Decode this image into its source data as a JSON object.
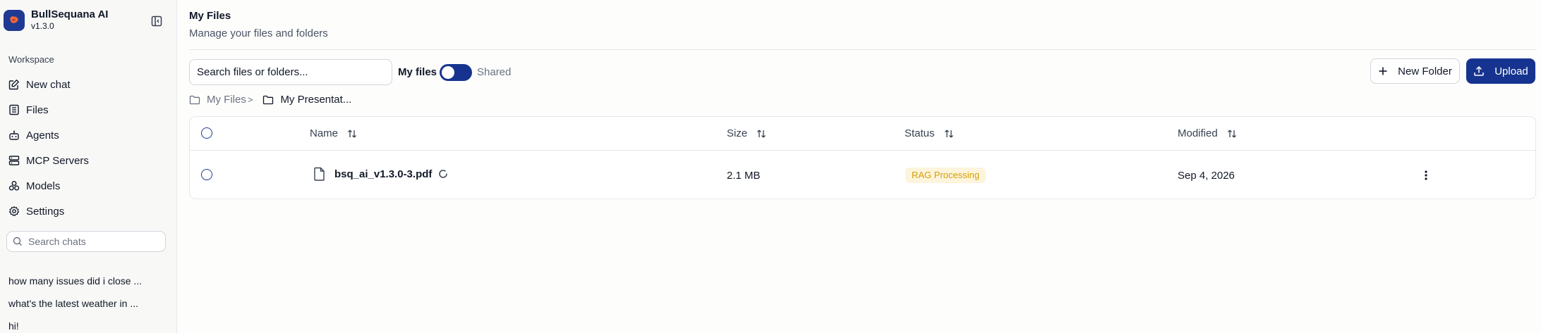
{
  "app": {
    "name": "BullSequana AI",
    "version": "v1.3.0"
  },
  "sidebar": {
    "section_label": "Workspace",
    "items": [
      {
        "label": "New chat",
        "icon": "edit-icon"
      },
      {
        "label": "Files",
        "icon": "file-list-icon"
      },
      {
        "label": "Agents",
        "icon": "bot-icon"
      },
      {
        "label": "MCP Servers",
        "icon": "server-icon"
      },
      {
        "label": "Models",
        "icon": "boxes-icon"
      },
      {
        "label": "Settings",
        "icon": "gear-icon"
      }
    ],
    "search_placeholder": "Search chats",
    "chats": [
      "how many issues did i close ...",
      "what's the latest weather in ...",
      "hi!"
    ]
  },
  "main": {
    "title": "My Files",
    "subtitle": "Manage your files and folders",
    "search_placeholder": "Search files or folders...",
    "toggle": {
      "left_label": "My files",
      "right_label": "Shared"
    },
    "new_folder_label": "New Folder",
    "upload_label": "Upload",
    "breadcrumb": [
      {
        "label": "My Files",
        "separator": ">"
      },
      {
        "label": "My Presentat..."
      }
    ],
    "table": {
      "columns": [
        "Name",
        "Size",
        "Status",
        "Modified"
      ],
      "rows": [
        {
          "name": "bsq_ai_v1.3.0-3.pdf",
          "size": "2.1 MB",
          "status": "RAG Processing",
          "modified": "Sep 4, 2026"
        }
      ]
    }
  },
  "colors": {
    "accent": "#16348f",
    "status_bg": "#fdf4dc",
    "status_text": "#d4a106"
  }
}
